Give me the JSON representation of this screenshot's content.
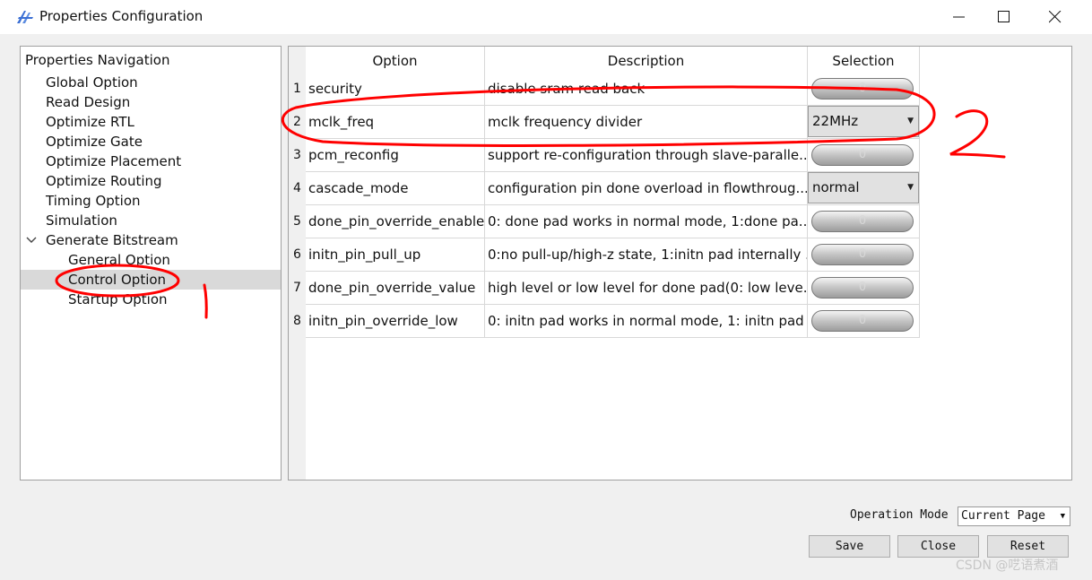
{
  "window": {
    "title": "Properties Configuration"
  },
  "nav": {
    "header": "Properties Navigation",
    "items": [
      {
        "label": "Global Option"
      },
      {
        "label": "Read Design"
      },
      {
        "label": "Optimize RTL"
      },
      {
        "label": "Optimize Gate"
      },
      {
        "label": "Optimize Placement"
      },
      {
        "label": "Optimize Routing"
      },
      {
        "label": "Timing Option"
      },
      {
        "label": "Simulation"
      },
      {
        "label": "Generate Bitstream",
        "expanded": true
      },
      {
        "label": "General Option"
      },
      {
        "label": "Control Option",
        "selected": true
      },
      {
        "label": "Startup Option"
      }
    ]
  },
  "table": {
    "headers": [
      "Option",
      "Description",
      "Selection"
    ],
    "rows": [
      {
        "num": "1",
        "option": "security",
        "description": "disable sram read back",
        "selection": {
          "type": "toggle",
          "value": "0"
        }
      },
      {
        "num": "2",
        "option": "mclk_freq",
        "description": "mclk frequency divider",
        "selection": {
          "type": "combo",
          "value": "22MHz"
        }
      },
      {
        "num": "3",
        "option": "pcm_reconfig",
        "description": "support re-configuration through slave-paralle...",
        "selection": {
          "type": "toggle",
          "value": "0"
        }
      },
      {
        "num": "4",
        "option": "cascade_mode",
        "description": "configuration pin done overload in flowthroug...",
        "selection": {
          "type": "combo",
          "value": "normal"
        }
      },
      {
        "num": "5",
        "option": "done_pin_override_enable",
        "description": "0: done pad works in normal mode, 1:done pa...",
        "selection": {
          "type": "toggle",
          "value": "0"
        }
      },
      {
        "num": "6",
        "option": "initn_pin_pull_up",
        "description": "0:no pull-up/high-z state, 1:initn pad internally ...",
        "selection": {
          "type": "toggle",
          "value": "0"
        }
      },
      {
        "num": "7",
        "option": "done_pin_override_value",
        "description": "high level or low level for done pad(0: low leve...",
        "selection": {
          "type": "toggle",
          "value": "0"
        }
      },
      {
        "num": "8",
        "option": "initn_pin_override_low",
        "description": "0: initn pad works in normal mode, 1: initn pad ...",
        "selection": {
          "type": "toggle",
          "value": "0"
        }
      }
    ]
  },
  "footer": {
    "operation_mode_label": "Operation Mode",
    "operation_mode_value": "Current Page",
    "save_label": "Save",
    "close_label": "Close",
    "reset_label": "Reset"
  },
  "watermark": "CSDN @呓语煮酒",
  "annotations": {
    "mark1": "1",
    "mark2": "2",
    "color": "#ff0000"
  },
  "colors": {
    "selected_row": "#d9d9d9",
    "accent_icon": "#3b6fd4"
  }
}
